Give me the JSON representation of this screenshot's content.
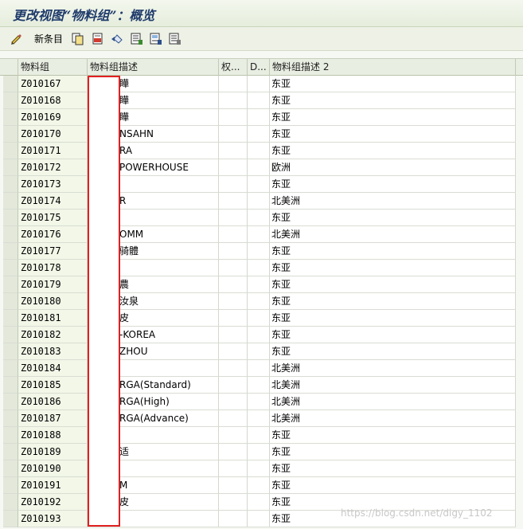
{
  "window": {
    "title": "更改视图“物料组”：概览"
  },
  "toolbar": {
    "new_entries_label": "新条目",
    "icons": [
      "edit-pen-icon",
      "copy-icon",
      "delete-icon",
      "undo-icon",
      "select-all-icon",
      "select-block-icon",
      "deselect-all-icon"
    ]
  },
  "table": {
    "columns": [
      "物料组",
      "物料组描述",
      "权...",
      "D...",
      "物料组描述 2"
    ],
    "rows": [
      {
        "code": "Z010167",
        "desc": "瞱",
        "desc2": "东亚"
      },
      {
        "code": "Z010168",
        "desc": "瞱",
        "desc2": "东亚"
      },
      {
        "code": "Z010169",
        "desc": "瞱",
        "desc2": "东亚"
      },
      {
        "code": "Z010170",
        "desc": "NSAHN",
        "desc2": "东亚"
      },
      {
        "code": "Z010171",
        "desc": "RA",
        "desc2": "东亚"
      },
      {
        "code": "Z010172",
        "desc": "POWERHOUSE",
        "desc2": "欧洲"
      },
      {
        "code": "Z010173",
        "desc": "",
        "desc2": "东亚"
      },
      {
        "code": "Z010174",
        "desc": "R",
        "desc2": "北美洲"
      },
      {
        "code": "Z010175",
        "desc": "",
        "desc2": "东亚"
      },
      {
        "code": "Z010176",
        "desc": "OMM",
        "desc2": "北美洲"
      },
      {
        "code": "Z010177",
        "desc": "骑體",
        "desc2": "东亚"
      },
      {
        "code": "Z010178",
        "desc": "",
        "desc2": "东亚"
      },
      {
        "code": "Z010179",
        "desc": "農",
        "desc2": "东亚"
      },
      {
        "code": "Z010180",
        "desc": "汝泉",
        "desc2": "东亚"
      },
      {
        "code": "Z010181",
        "desc": "皮",
        "desc2": "东亚"
      },
      {
        "code": "Z010182",
        "desc": "-KOREA",
        "desc2": "东亚"
      },
      {
        "code": "Z010183",
        "desc": "ZHOU",
        "desc2": "东亚"
      },
      {
        "code": "Z010184",
        "desc": "",
        "desc2": "北美洲"
      },
      {
        "code": "Z010185",
        "desc": "RGA(Standard)",
        "desc2": "北美洲"
      },
      {
        "code": "Z010186",
        "desc": "RGA(High)",
        "desc2": "北美洲"
      },
      {
        "code": "Z010187",
        "desc": "RGA(Advance)",
        "desc2": "北美洲"
      },
      {
        "code": "Z010188",
        "desc": "",
        "desc2": "东亚"
      },
      {
        "code": "Z010189",
        "desc": "适",
        "desc2": "东亚"
      },
      {
        "code": "Z010190",
        "desc": "",
        "desc2": "东亚"
      },
      {
        "code": "Z010191",
        "desc": "M",
        "desc2": "东亚"
      },
      {
        "code": "Z010192",
        "desc": "皮",
        "desc2": "东亚"
      },
      {
        "code": "Z010193",
        "desc": "",
        "desc2": "东亚"
      }
    ]
  },
  "watermark": "https://blog.csdn.net/digy_1102",
  "colors": {
    "title": "#1f3b6b",
    "redaction_border": "#e02020",
    "key_column_bg": "#f2f7e8"
  }
}
